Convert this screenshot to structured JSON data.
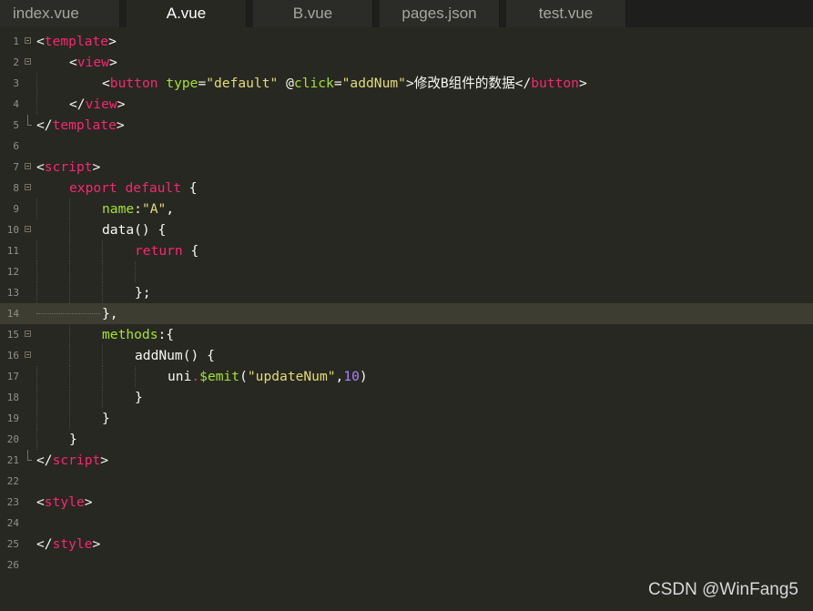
{
  "tabs": [
    {
      "label": "index.vue"
    },
    {
      "label": "A.vue"
    },
    {
      "label": "B.vue"
    },
    {
      "label": "pages.json"
    },
    {
      "label": "test.vue"
    }
  ],
  "active_tab": "A.vue",
  "code": {
    "l1": {
      "num": "1",
      "t1": "<",
      "t2": "template",
      "t3": ">"
    },
    "l2": {
      "num": "2",
      "t1": "<",
      "t2": "view",
      "t3": ">"
    },
    "l3": {
      "num": "3",
      "t1": "<",
      "t2": "button",
      "a1": " type",
      "e1": "=",
      "s1": "\"default\"",
      "a2": " @",
      "a2b": "click",
      "e2": "=",
      "s2": "\"addNum\"",
      "txt": ">修改B组件的数据</",
      "t4": "button",
      "t5": ">"
    },
    "l4": {
      "num": "4",
      "t1": "</",
      "t2": "view",
      "t3": ">"
    },
    "l5": {
      "num": "5",
      "t1": "</",
      "t2": "template",
      "t3": ">"
    },
    "l6": {
      "num": "6"
    },
    "l7": {
      "num": "7",
      "t1": "<",
      "t2": "script",
      "t3": ">"
    },
    "l8": {
      "num": "8",
      "k1": "export default",
      "p1": " {"
    },
    "l9": {
      "num": "9",
      "a1": "name",
      "p1": ":",
      "s1": "\"A\"",
      "p2": ","
    },
    "l10": {
      "num": "10",
      "p1": "data() {"
    },
    "l11": {
      "num": "11",
      "k1": "return",
      "p1": " {"
    },
    "l12": {
      "num": "12"
    },
    "l13": {
      "num": "13",
      "p1": "};"
    },
    "l14": {
      "num": "14",
      "p1": "},"
    },
    "l15": {
      "num": "15",
      "a1": "methods",
      "p1": ":{"
    },
    "l16": {
      "num": "16",
      "p1": "addNum() {"
    },
    "l17": {
      "num": "17",
      "p1": "uni",
      "k1": ".",
      "f1": "$emit",
      "p2": "(",
      "s1": "\"updateNum\"",
      "p3": ",",
      "n1": "10",
      "p4": ")"
    },
    "l18": {
      "num": "18",
      "p1": "}"
    },
    "l19": {
      "num": "19",
      "p1": "}"
    },
    "l20": {
      "num": "20",
      "p1": "}"
    },
    "l21": {
      "num": "21",
      "t1": "</",
      "t2": "script",
      "t3": ">"
    },
    "l22": {
      "num": "22"
    },
    "l23": {
      "num": "23",
      "t1": "<",
      "t2": "style",
      "t3": ">"
    },
    "l24": {
      "num": "24"
    },
    "l25": {
      "num": "25",
      "t1": "</",
      "t2": "style",
      "t3": ">"
    },
    "l26": {
      "num": "26"
    }
  },
  "watermark": "CSDN @WinFang5",
  "colors": {
    "background": "#272822",
    "tag": "#f92672",
    "attribute": "#a6e22e",
    "string": "#e6db74",
    "number": "#ae81ff",
    "plain": "#f8f8f2"
  }
}
